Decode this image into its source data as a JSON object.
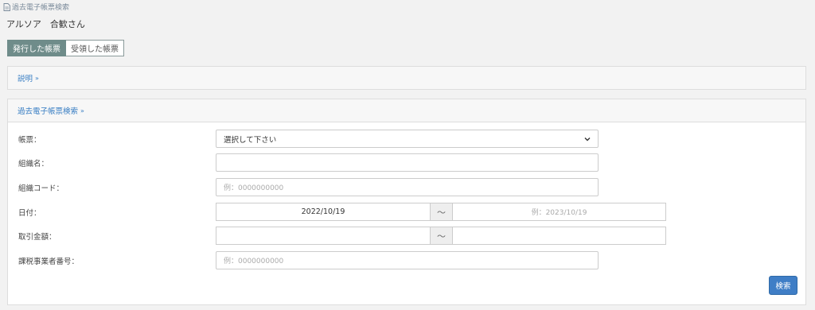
{
  "breadcrumb": {
    "icon": "document-icon",
    "label": "過去電子帳票検索"
  },
  "company_name": "アルソア　合歓さん",
  "tabs": [
    {
      "label": "発行した帳票",
      "active": true
    },
    {
      "label": "受領した帳票",
      "active": false
    }
  ],
  "description_panel": {
    "title": "説明",
    "toggle_icon": "chevron-double-down-icon"
  },
  "search_panel": {
    "title": "過去電子帳票検索",
    "toggle_icon": "chevron-double-down-icon",
    "fields": {
      "form_type": {
        "label": "帳票：",
        "value": "選択して下さい"
      },
      "org_name": {
        "label": "組織名：",
        "value": ""
      },
      "org_code": {
        "label": "組織コード：",
        "placeholder": "例：0000000000"
      },
      "date": {
        "label": "日付：",
        "from": "2022/10/19",
        "separator": "〜",
        "to_placeholder": "例：2023/10/19"
      },
      "amount": {
        "label": "取引金額：",
        "from": "",
        "separator": "〜",
        "to": ""
      },
      "tax_id": {
        "label": "課税事業者番号：",
        "placeholder": "例：0000000000"
      }
    },
    "search_button": "検索"
  },
  "colors": {
    "tab_active": "#6f8c8a",
    "link_blue": "#3a7fc4",
    "button_blue": "#3f7ec6",
    "background": "#f2f2f2"
  }
}
